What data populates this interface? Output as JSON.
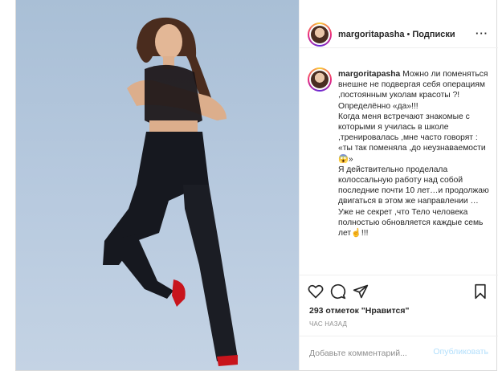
{
  "post": {
    "username": "margoritapasha",
    "separator": "•",
    "follow_status": "Подписки",
    "more_label": "···",
    "caption_lines": [
      "Можно ли поменяться внешне не подвергая себя операциям ,постоянным уколам красоты ?!",
      "Определённо «да»!!!",
      "Когда меня встречают знакомые с которыми я училась в школе ,тренировалась ,мне часто говорят : «ты так поменяла ,до неузнаваемости😱»",
      "Я действительно проделала колоссальную работу над собой последние почти 10 лет…и продолжаю двигаться в этом же направлении …",
      "Уже не секрет ,что Тело человека полностью обновляется каждые семь лет☝️!!!"
    ],
    "likes_text": "293 отметок \"Нравится\"",
    "time_text": "ЧАС НАЗАД",
    "comment_placeholder": "Добавьте комментарий...",
    "publish_label": "Опубликовать"
  },
  "icons": {
    "like": "heart-icon",
    "comment": "comment-icon",
    "share": "share-icon",
    "save": "bookmark-icon"
  },
  "colors": {
    "text": "#262626",
    "muted": "#8e8e8e",
    "publish_disabled": "#b2dffc",
    "photo_bg": "#b8cadf"
  }
}
